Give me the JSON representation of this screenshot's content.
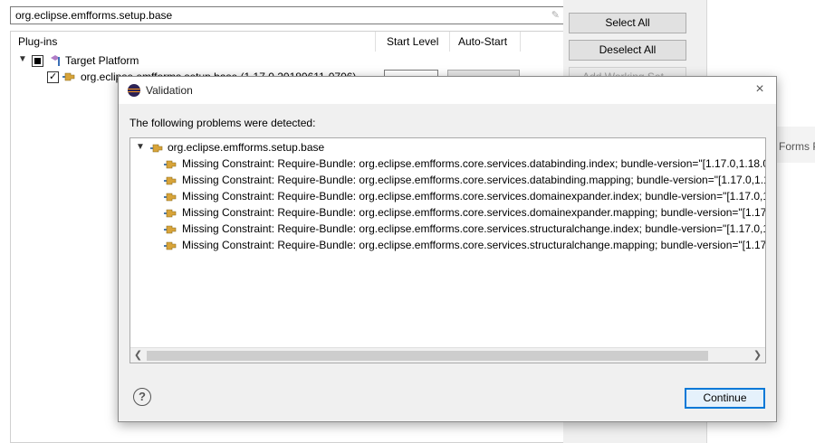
{
  "background": {
    "filter": {
      "value": "org.eclipse.emfforms.setup.base"
    },
    "table": {
      "columns": [
        "Plug-ins",
        "Start Level",
        "Auto-Start"
      ],
      "rows": [
        {
          "label": "Target Platform"
        },
        {
          "label": "org.eclipse.emfforms.setup.base (1.17.0.20180611-0706)"
        }
      ]
    },
    "side_buttons": [
      "Select All",
      "Deselect All",
      "Add Working Set..."
    ],
    "peek_text": "Forms P"
  },
  "dialog": {
    "title": "Validation",
    "close_glyph": "×",
    "message": "The following problems were detected:",
    "tree": {
      "root": "org.eclipse.emfforms.setup.base",
      "problems": [
        "Missing Constraint: Require-Bundle: org.eclipse.emfforms.core.services.databinding.index; bundle-version=\"[1.17.0,1.18.0)",
        "Missing Constraint: Require-Bundle: org.eclipse.emfforms.core.services.databinding.mapping; bundle-version=\"[1.17.0,1.1",
        "Missing Constraint: Require-Bundle: org.eclipse.emfforms.core.services.domainexpander.index; bundle-version=\"[1.17.0,1.",
        "Missing Constraint: Require-Bundle: org.eclipse.emfforms.core.services.domainexpander.mapping; bundle-version=\"[1.17.",
        "Missing Constraint: Require-Bundle: org.eclipse.emfforms.core.services.structuralchange.index; bundle-version=\"[1.17.0,1.",
        "Missing Constraint: Require-Bundle: org.eclipse.emfforms.core.services.structuralchange.mapping; bundle-version=\"[1.17."
      ]
    },
    "help_glyph": "?",
    "continue_label": "Continue"
  },
  "colors": {
    "accent": "#0078d7",
    "plugin_icon": "#d8a43a"
  }
}
